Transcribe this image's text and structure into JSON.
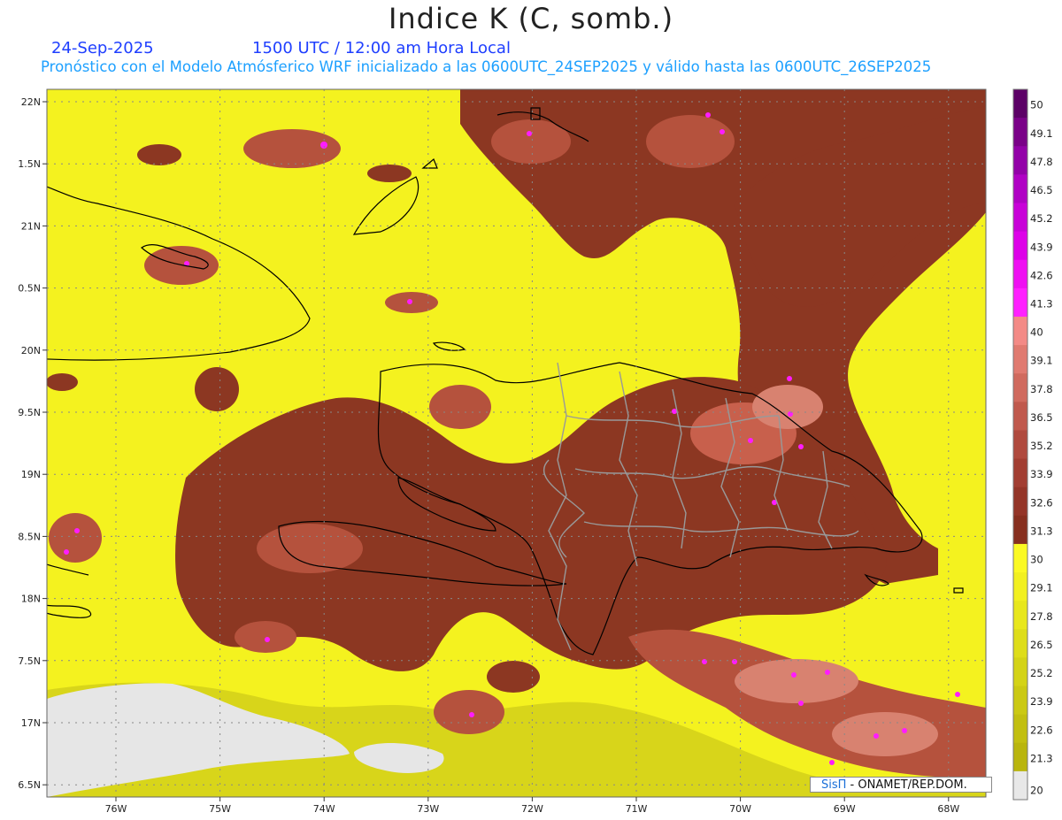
{
  "header": {
    "title": "Indice K (C, somb.)",
    "date": "24-Sep-2025",
    "time": "1500 UTC / 12:00 am Hora Local",
    "subtitle": "Pronóstico con el Modelo Atmósferico WRF inicializado a las 0600UTC_24SEP2025 y válido hasta las  0600UTC_26SEP2025"
  },
  "axes": {
    "lat_labels": [
      "22N",
      "1.5N",
      "21N",
      "0.5N",
      "20N",
      "9.5N",
      "19N",
      "8.5N",
      "18N",
      "7.5N",
      "17N",
      "6.5N"
    ],
    "lon_labels": [
      "76W",
      "75W",
      "74W",
      "73W",
      "72W",
      "71W",
      "70W",
      "69W",
      "68W"
    ],
    "lat_range": [
      16.5,
      22
    ],
    "lon_range": [
      -76.6,
      -67.6
    ]
  },
  "colorbar": {
    "labels": [
      "50",
      "49.1",
      "47.8",
      "46.5",
      "45.2",
      "43.9",
      "42.6",
      "41.3",
      "40",
      "39.1",
      "37.8",
      "36.5",
      "35.2",
      "33.9",
      "32.6",
      "31.3",
      "30",
      "29.1",
      "27.8",
      "26.5",
      "25.2",
      "23.9",
      "22.6",
      "21.3",
      "20"
    ],
    "colors": [
      "#5c0066",
      "#7a0088",
      "#9300a8",
      "#b000c4",
      "#c800d8",
      "#dd00e8",
      "#ef10f2",
      "#ff20ff",
      "#f38a86",
      "#e07a70",
      "#d06a5e",
      "#c0594d",
      "#b04a3e",
      "#a23e32",
      "#943528",
      "#872f1f",
      "#fbf923",
      "#f2f020",
      "#e8e71c",
      "#dedd19",
      "#d4d316",
      "#cbc913",
      "#c2bf10",
      "#b9b50d",
      "#e8e8e8"
    ]
  },
  "colors": {
    "yellow": "#f4f21f",
    "yellow_dark": "#d8d51a",
    "brown": "#8c3722",
    "brown_mid": "#b5523d",
    "salmon": "#d88270",
    "magenta": "#ff1cff",
    "land_gray": "#e6e6e6"
  },
  "credit": {
    "logo": "SisΠ",
    "text": " - ONAMET/REP.DOM."
  }
}
